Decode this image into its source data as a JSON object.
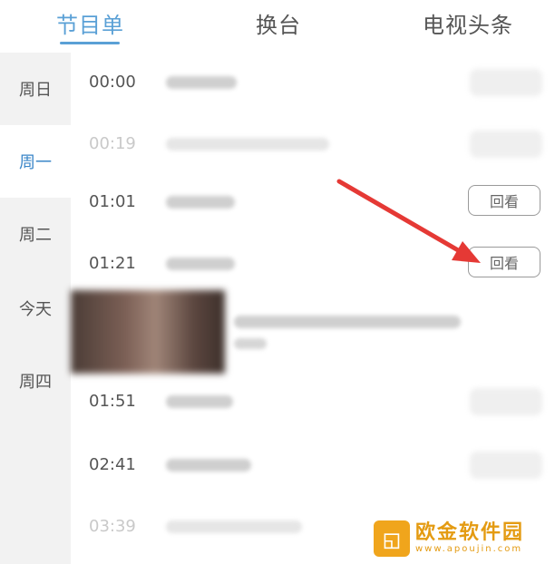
{
  "tabs": [
    {
      "label": "节目单",
      "active": true
    },
    {
      "label": "换台",
      "active": false
    },
    {
      "label": "电视头条",
      "active": false
    }
  ],
  "days": [
    {
      "label": "周日",
      "active": false
    },
    {
      "label": "周一",
      "active": true
    },
    {
      "label": "周二",
      "active": false
    },
    {
      "label": "今天",
      "active": false
    },
    {
      "label": "周四",
      "active": false
    }
  ],
  "programs": [
    {
      "time": "00:00",
      "faded": false,
      "replay_label": null
    },
    {
      "time": "00:19",
      "faded": true,
      "replay_label": null
    },
    {
      "time": "01:01",
      "faded": false,
      "replay_label": "回看"
    },
    {
      "time": "01:21",
      "faded": false,
      "replay_label": "回看"
    },
    {
      "time": "01:51",
      "faded": false,
      "replay_label": null
    },
    {
      "time": "02:41",
      "faded": false,
      "replay_label": null
    },
    {
      "time": "03:39",
      "faded": true,
      "replay_label": null
    }
  ],
  "watermark": {
    "main": "欧金软件园",
    "sub": "www.apoujin.com"
  },
  "colors": {
    "accent": "#5aa0d6",
    "arrow": "#e53935",
    "watermark": "#f0a51c"
  }
}
